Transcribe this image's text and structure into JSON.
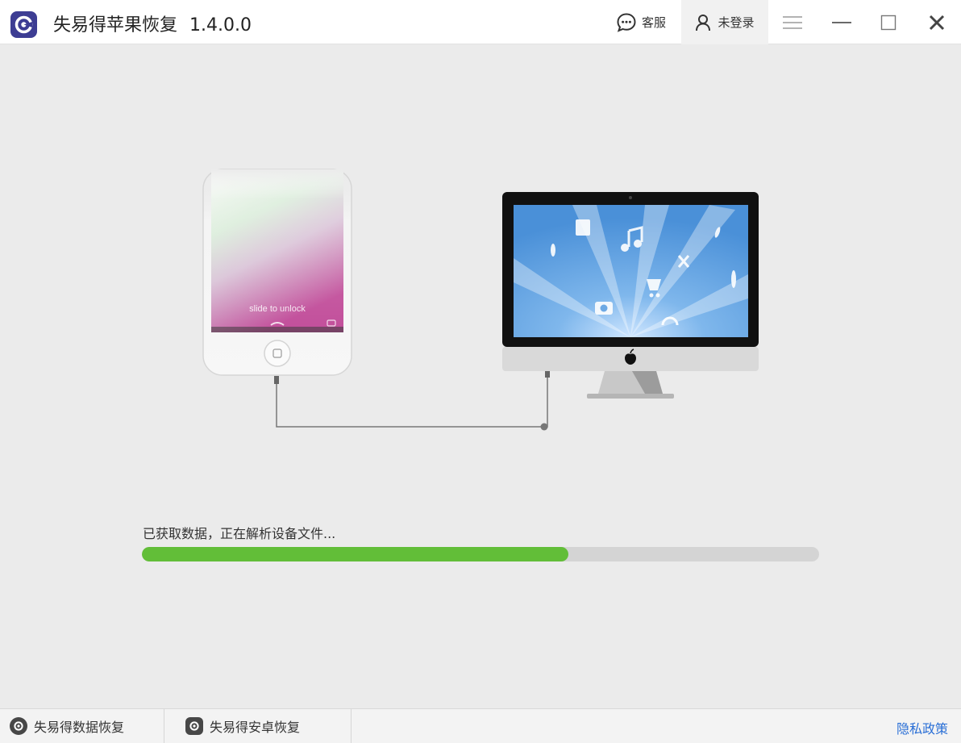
{
  "titlebar": {
    "app_name": "失易得苹果恢复",
    "version": "1.4.0.0",
    "support_label": "客服",
    "login_label": "未登录"
  },
  "illustration": {
    "lock_text": "slide to unlock"
  },
  "progress": {
    "status_text": "已获取数据，正在解析设备文件...",
    "fraction": 0.63,
    "fill_color": "#62be38",
    "track_color": "#d4d4d4"
  },
  "footer": {
    "link1_label": "失易得数据恢复",
    "link2_label": "失易得安卓恢复",
    "privacy_label": "隐私政策",
    "privacy_color": "#2a6fd6"
  },
  "icons": [
    "app-logo-icon",
    "chat-bubble-icon",
    "user-icon",
    "menu-icon",
    "minimize-icon",
    "maximize-icon",
    "close-icon",
    "apple-icon"
  ]
}
